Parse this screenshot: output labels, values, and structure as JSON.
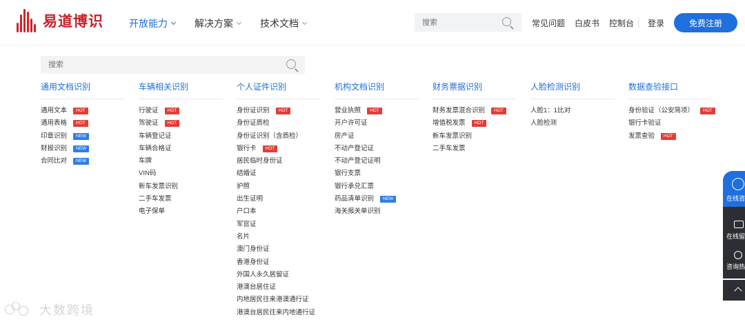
{
  "header": {
    "logo_text": "易道博识",
    "nav": [
      {
        "label": "开放能力",
        "active": true
      },
      {
        "label": "解决方案",
        "active": false
      },
      {
        "label": "技术文档",
        "active": false
      }
    ],
    "search_placeholder": "搜索",
    "links": [
      "常见问题",
      "白皮书",
      "控制台"
    ],
    "login": "登录",
    "register": "免费注册"
  },
  "panel": {
    "search_placeholder": "搜索",
    "columns": [
      {
        "title": "通用文档识别",
        "items": [
          {
            "label": "通用文本",
            "badge": "HOT"
          },
          {
            "label": "通用表格",
            "badge": "HOT"
          },
          {
            "label": "印章识别",
            "badge": "NEW"
          },
          {
            "label": "财报识别",
            "badge": "NEW"
          },
          {
            "label": "合同比对",
            "badge": "NEW"
          }
        ]
      },
      {
        "title": "车辆相关识别",
        "items": [
          {
            "label": "行驶证",
            "badge": "HOT"
          },
          {
            "label": "驾驶证",
            "badge": "HOT"
          },
          {
            "label": "车辆登记证",
            "badge": ""
          },
          {
            "label": "车辆合格证",
            "badge": ""
          },
          {
            "label": "车牌",
            "badge": ""
          },
          {
            "label": "VIN码",
            "badge": ""
          },
          {
            "label": "新车发票识别",
            "badge": ""
          },
          {
            "label": "二手车发票",
            "badge": ""
          },
          {
            "label": "电子保单",
            "badge": ""
          }
        ]
      },
      {
        "title": "个人证件识别",
        "items": [
          {
            "label": "身份证识别",
            "badge": "HOT"
          },
          {
            "label": "身份证质检",
            "badge": ""
          },
          {
            "label": "身份证识别（含质检）",
            "badge": ""
          },
          {
            "label": "银行卡",
            "badge": "HOT"
          },
          {
            "label": "居民临时身份证",
            "badge": ""
          },
          {
            "label": "结婚证",
            "badge": ""
          },
          {
            "label": "护照",
            "badge": ""
          },
          {
            "label": "出生证明",
            "badge": ""
          },
          {
            "label": "户口本",
            "badge": ""
          },
          {
            "label": "军官证",
            "badge": ""
          },
          {
            "label": "名片",
            "badge": ""
          },
          {
            "label": "澳门身份证",
            "badge": ""
          },
          {
            "label": "香港身份证",
            "badge": ""
          },
          {
            "label": "外国人永久居留证",
            "badge": ""
          },
          {
            "label": "港澳台居住证",
            "badge": ""
          },
          {
            "label": "内地居民往来港澳通行证",
            "badge": ""
          },
          {
            "label": "港澳台居民往来内地通行证",
            "badge": ""
          }
        ]
      },
      {
        "title": "机构文档识别",
        "items": [
          {
            "label": "营业执照",
            "badge": "HOT"
          },
          {
            "label": "开户许可证",
            "badge": ""
          },
          {
            "label": "房产证",
            "badge": ""
          },
          {
            "label": "不动产登记证",
            "badge": ""
          },
          {
            "label": "不动产登记证明",
            "badge": ""
          },
          {
            "label": "银行支票",
            "badge": ""
          },
          {
            "label": "银行承兑汇票",
            "badge": ""
          },
          {
            "label": "药品清单识别",
            "badge": "NEW"
          },
          {
            "label": "海关报关单识别",
            "badge": ""
          }
        ]
      },
      {
        "title": "财务票据识别",
        "items": [
          {
            "label": "财务发票混合识别",
            "badge": "HOT"
          },
          {
            "label": "增值税发票",
            "badge": "HOT"
          },
          {
            "label": "新车发票识别",
            "badge": ""
          },
          {
            "label": "二手车发票",
            "badge": ""
          }
        ]
      },
      {
        "title": "人脸检测识别",
        "items": [
          {
            "label": "人脸1：1比对",
            "badge": ""
          },
          {
            "label": "人脸检测",
            "badge": ""
          }
        ]
      },
      {
        "title": "数据查验接口",
        "items": [
          {
            "label": "身份验证（公安简项）",
            "badge": "HOT"
          },
          {
            "label": "银行卡验证",
            "badge": ""
          },
          {
            "label": "发票查验",
            "badge": "HOT"
          }
        ]
      }
    ]
  },
  "float_bar": {
    "items": [
      "在线咨",
      "在线留",
      "咨询热"
    ]
  },
  "watermark": {
    "text": "大数跨境"
  },
  "colors": {
    "brand_red": "#c8202a",
    "accent_blue": "#1f6fde",
    "hot": "#e23d36",
    "new": "#2f7ee6"
  }
}
